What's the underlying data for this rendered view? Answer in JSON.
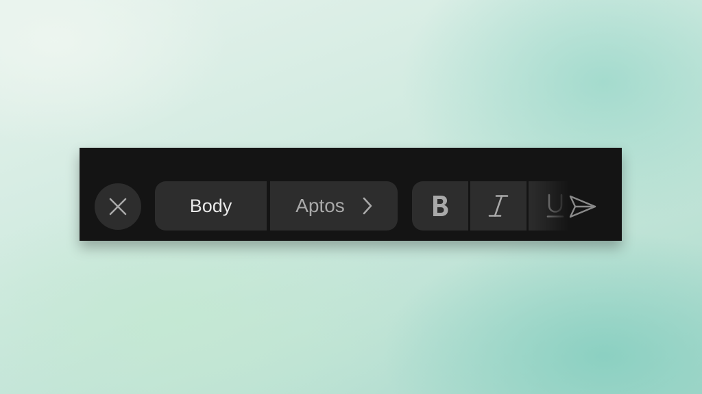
{
  "toolbar": {
    "close_icon": "close-icon",
    "style_label": "Body",
    "font_label": "Aptos",
    "font_chevron_icon": "chevron-right-icon",
    "bold_icon": "bold-icon",
    "italic_icon": "italic-icon",
    "underline_icon": "underline-icon",
    "send_icon": "send-icon"
  },
  "colors": {
    "toolbar_background": "#141414",
    "button_background": "#2d2d2d",
    "active_text": "#e8e8e8",
    "muted_text": "#a9a9a9"
  }
}
